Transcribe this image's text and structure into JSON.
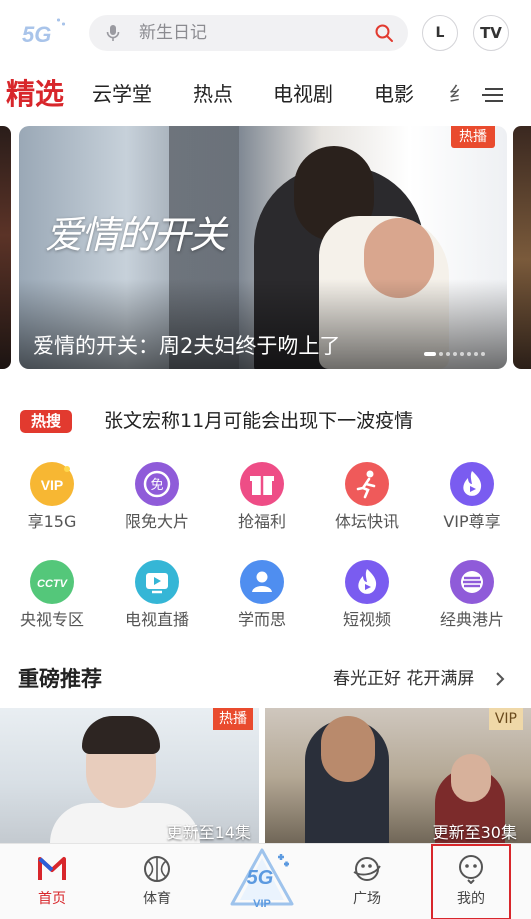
{
  "header": {
    "logo_text": "5G",
    "search_placeholder": "新生日记",
    "left_button": "L",
    "tv_button": "TV"
  },
  "tabs": [
    {
      "label": "精选",
      "active": true
    },
    {
      "label": "云学堂"
    },
    {
      "label": "热点"
    },
    {
      "label": "电视剧"
    },
    {
      "label": "电影"
    },
    {
      "label": "纟"
    }
  ],
  "banner": {
    "title_art": "爱情的开关",
    "caption": "爱情的开关：周2夫妇终于吻上了",
    "tag": "热播",
    "page_count": 8,
    "current_page": 1
  },
  "hot_search": {
    "tag": "热搜",
    "text": "张文宏称11月可能会出现下一波疫情"
  },
  "quick_icons": [
    {
      "label": "享15G",
      "icon": "vip-icon",
      "color": "#f5a623"
    },
    {
      "label": "限免大片",
      "icon": "free-icon",
      "color": "#8f5bd9"
    },
    {
      "label": "抢福利",
      "icon": "gift-icon",
      "color": "#ee4d86"
    },
    {
      "label": "体坛快讯",
      "icon": "sports-icon",
      "color": "#ef5a5a"
    },
    {
      "label": "VIP尊享",
      "icon": "play-flame-icon",
      "color": "#7a5cf0"
    },
    {
      "label": "央视专区",
      "icon": "cctv-icon",
      "color": "#54c77a"
    },
    {
      "label": "电视直播",
      "icon": "tv-live-icon",
      "color": "#35b6d6"
    },
    {
      "label": "学而思",
      "icon": "user-icon",
      "color": "#4f8ef0"
    },
    {
      "label": "短视频",
      "icon": "short-video-icon",
      "color": "#7a5cf0"
    },
    {
      "label": "经典港片",
      "icon": "film-reel-icon",
      "color": "#8f5bd9"
    }
  ],
  "recommend": {
    "title": "重磅推荐",
    "more": "春光正好 花开满屏"
  },
  "thumbs": [
    {
      "tag": "热播",
      "update": "更新至14集"
    },
    {
      "tag": "VIP",
      "update": "更新至30集"
    }
  ],
  "bottom_nav": [
    {
      "label": "首页",
      "icon": "home-logo-icon",
      "active": true
    },
    {
      "label": "体育",
      "icon": "basketball-icon"
    },
    {
      "label": "VIP",
      "icon": "5g-vip-icon"
    },
    {
      "label": "广场",
      "icon": "planet-icon"
    },
    {
      "label": "我的",
      "icon": "profile-icon"
    }
  ],
  "colors": {
    "accent": "#d8262b",
    "hot": "#e94b2e"
  }
}
